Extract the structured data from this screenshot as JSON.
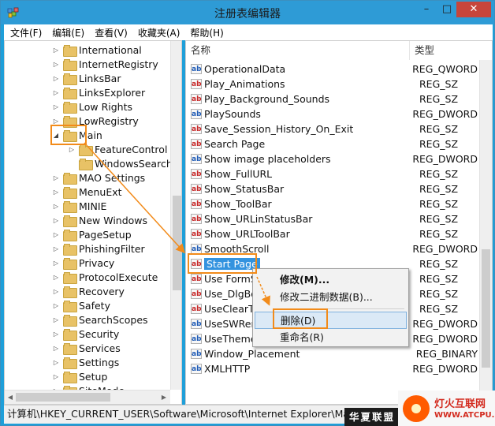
{
  "window": {
    "title": "注册表编辑器",
    "minimize": "–",
    "maximize": "□",
    "close": "✕"
  },
  "menu": [
    "文件(F)",
    "编辑(E)",
    "查看(V)",
    "收藏夹(A)",
    "帮助(H)"
  ],
  "tree": {
    "items": [
      {
        "label": "International",
        "level": 0,
        "expander": "right"
      },
      {
        "label": "InternetRegistry",
        "level": 0,
        "expander": "right"
      },
      {
        "label": "LinksBar",
        "level": 0,
        "expander": "right"
      },
      {
        "label": "LinksExplorer",
        "level": 0,
        "expander": "right"
      },
      {
        "label": "Low Rights",
        "level": 0,
        "expander": "right"
      },
      {
        "label": "LowRegistry",
        "level": 0,
        "expander": "right"
      },
      {
        "label": "Main",
        "level": 0,
        "expander": "down"
      },
      {
        "label": "FeatureControl",
        "level": 1,
        "expander": "right"
      },
      {
        "label": "WindowsSearch",
        "level": 1,
        "expander": "none"
      },
      {
        "label": "MAO Settings",
        "level": 0,
        "expander": "right"
      },
      {
        "label": "MenuExt",
        "level": 0,
        "expander": "right"
      },
      {
        "label": "MINIE",
        "level": 0,
        "expander": "right"
      },
      {
        "label": "New Windows",
        "level": 0,
        "expander": "right"
      },
      {
        "label": "PageSetup",
        "level": 0,
        "expander": "right"
      },
      {
        "label": "PhishingFilter",
        "level": 0,
        "expander": "right"
      },
      {
        "label": "Privacy",
        "level": 0,
        "expander": "right"
      },
      {
        "label": "ProtocolExecute",
        "level": 0,
        "expander": "right"
      },
      {
        "label": "Recovery",
        "level": 0,
        "expander": "right"
      },
      {
        "label": "Safety",
        "level": 0,
        "expander": "right"
      },
      {
        "label": "SearchScopes",
        "level": 0,
        "expander": "right"
      },
      {
        "label": "Security",
        "level": 0,
        "expander": "right"
      },
      {
        "label": "Services",
        "level": 0,
        "expander": "right"
      },
      {
        "label": "Settings",
        "level": 0,
        "expander": "right"
      },
      {
        "label": "Setup",
        "level": 0,
        "expander": "right"
      },
      {
        "label": "SiteMode",
        "level": 0,
        "expander": "right"
      }
    ]
  },
  "values": {
    "header_name": "名称",
    "header_type": "类型",
    "rows": [
      {
        "name": "OperationalData",
        "type": "REG_QWORD",
        "icon": "binary"
      },
      {
        "name": "Play_Animations",
        "type": "REG_SZ",
        "icon": "string"
      },
      {
        "name": "Play_Background_Sounds",
        "type": "REG_SZ",
        "icon": "string"
      },
      {
        "name": "PlaySounds",
        "type": "REG_DWORD",
        "icon": "binary"
      },
      {
        "name": "Save_Session_History_On_Exit",
        "type": "REG_SZ",
        "icon": "string"
      },
      {
        "name": "Search Page",
        "type": "REG_SZ",
        "icon": "string"
      },
      {
        "name": "Show image placeholders",
        "type": "REG_DWORD",
        "icon": "binary"
      },
      {
        "name": "Show_FullURL",
        "type": "REG_SZ",
        "icon": "string"
      },
      {
        "name": "Show_StatusBar",
        "type": "REG_SZ",
        "icon": "string"
      },
      {
        "name": "Show_ToolBar",
        "type": "REG_SZ",
        "icon": "string"
      },
      {
        "name": "Show_URLinStatusBar",
        "type": "REG_SZ",
        "icon": "string"
      },
      {
        "name": "Show_URLToolBar",
        "type": "REG_SZ",
        "icon": "string"
      },
      {
        "name": "SmoothScroll",
        "type": "REG_DWORD",
        "icon": "binary"
      },
      {
        "name": "Start Page",
        "type": "REG_SZ",
        "icon": "string",
        "selected": true
      },
      {
        "name": "Use FormSuggest",
        "type": "REG_SZ",
        "icon": "string"
      },
      {
        "name": "Use_DlgBox_Colors",
        "type": "REG_SZ",
        "icon": "string"
      },
      {
        "name": "UseClearType",
        "type": "REG_SZ",
        "icon": "string"
      },
      {
        "name": "UseSWRender",
        "type": "REG_DWORD",
        "icon": "binary"
      },
      {
        "name": "UseThemes",
        "type": "REG_DWORD",
        "icon": "binary"
      },
      {
        "name": "Window_Placement",
        "type": "REG_BINARY",
        "icon": "binary"
      },
      {
        "name": "XMLHTTP",
        "type": "REG_DWORD",
        "icon": "binary"
      }
    ]
  },
  "context_menu": {
    "modify": "修改(M)...",
    "modify_binary": "修改二进制数据(B)...",
    "delete": "删除(D)",
    "rename": "重命名(R)"
  },
  "statusbar": {
    "path": "计算机\\HKEY_CURRENT_USER\\Software\\Microsoft\\Internet Explorer\\Main"
  },
  "watermark": {
    "brand_dark": "华夏联盟",
    "brand_cn": "灯火互联网",
    "brand_url": "WWW.ATCPU.COM"
  },
  "colors": {
    "title_bar": "#2e9bd6",
    "selection": "#3393df",
    "highlight": "#f28b1a",
    "close": "#c7453b"
  }
}
